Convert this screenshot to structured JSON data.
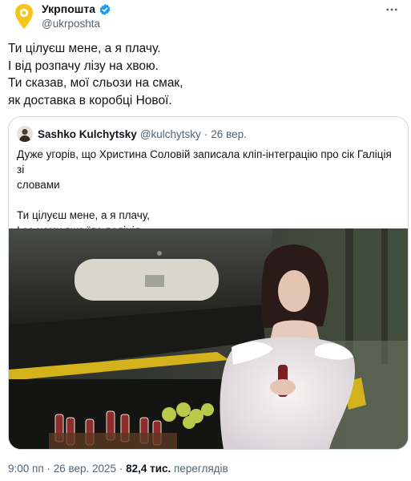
{
  "account": {
    "display_name": "Укрпошта",
    "handle": "@ukrposhta",
    "verified_badge_color": "#1d9bf0",
    "avatar_color": "#f5c61a"
  },
  "tweet": {
    "lines": [
      "Ти цілуєш мене, а я плачу.",
      "І від розпачу лізу на хвою.",
      "Ти сказав, мої сльози на смак,",
      "як доставка в коробці Нової."
    ]
  },
  "quote": {
    "author_name": "Sashko Kulchytsky",
    "author_handle": "@kulchytsky",
    "separator": "·",
    "date": "26 вер.",
    "text_lines": [
      "Дуже угорів, що Христина Соловій записала кліп-інтеграцію про сік Галіція зі",
      "словами",
      "",
      "Ти цілуєш мене, а я плачу,",
      "І за нами вже їде поліція...."
    ]
  },
  "meta": {
    "time": "9:00 пп",
    "separator": "·",
    "date": "26 вер. 2025",
    "views_count": "82,4 тис.",
    "views_label": "переглядів"
  },
  "icons": {
    "more": "more-horizontal-icon",
    "verified": "verified-badge-icon",
    "avatar": "ukrposhta-logo-icon"
  }
}
